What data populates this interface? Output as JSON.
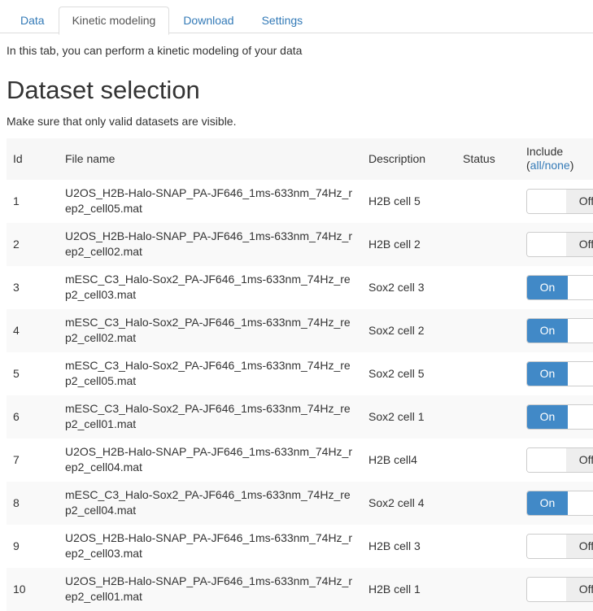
{
  "tabs": [
    {
      "label": "Data",
      "active": false
    },
    {
      "label": "Kinetic modeling",
      "active": true
    },
    {
      "label": "Download",
      "active": false
    },
    {
      "label": "Settings",
      "active": false
    }
  ],
  "intro_text": "In this tab, you can perform a kinetic modeling of your data",
  "page_title": "Dataset selection",
  "subtitle": "Make sure that only valid datasets are visible.",
  "colors": {
    "link": "#337ab7",
    "toggle_on": "#4189c7",
    "toggle_off_track": "#eeeeee",
    "header_bg": "#f7f7f7",
    "row_stripe": "#f9f9f9",
    "border": "#dddddd"
  },
  "table": {
    "headers": {
      "id": "Id",
      "file_name": "File name",
      "description": "Description",
      "status": "Status",
      "include": "Include",
      "include_all": "all",
      "include_separator": "/",
      "include_none": "none",
      "include_open_paren": "(",
      "include_close_paren": ")"
    },
    "toggle_labels": {
      "on": "On",
      "off": "Off"
    },
    "rows": [
      {
        "id": "1",
        "file_name": "U2OS_H2B-Halo-SNAP_PA-JF646_1ms-633nm_74Hz_rep2_cell05.mat",
        "description": "H2B cell 5",
        "status": "",
        "include": "Off"
      },
      {
        "id": "2",
        "file_name": "U2OS_H2B-Halo-SNAP_PA-JF646_1ms-633nm_74Hz_rep2_cell02.mat",
        "description": "H2B cell 2",
        "status": "",
        "include": "Off"
      },
      {
        "id": "3",
        "file_name": "mESC_C3_Halo-Sox2_PA-JF646_1ms-633nm_74Hz_rep2_cell03.mat",
        "description": "Sox2 cell 3",
        "status": "",
        "include": "On"
      },
      {
        "id": "4",
        "file_name": "mESC_C3_Halo-Sox2_PA-JF646_1ms-633nm_74Hz_rep2_cell02.mat",
        "description": "Sox2 cell 2",
        "status": "",
        "include": "On"
      },
      {
        "id": "5",
        "file_name": "mESC_C3_Halo-Sox2_PA-JF646_1ms-633nm_74Hz_rep2_cell05.mat",
        "description": "Sox2 cell 5",
        "status": "",
        "include": "On"
      },
      {
        "id": "6",
        "file_name": "mESC_C3_Halo-Sox2_PA-JF646_1ms-633nm_74Hz_rep2_cell01.mat",
        "description": "Sox2 cell 1",
        "status": "",
        "include": "On"
      },
      {
        "id": "7",
        "file_name": "U2OS_H2B-Halo-SNAP_PA-JF646_1ms-633nm_74Hz_rep2_cell04.mat",
        "description": "H2B cell4",
        "status": "",
        "include": "Off"
      },
      {
        "id": "8",
        "file_name": "mESC_C3_Halo-Sox2_PA-JF646_1ms-633nm_74Hz_rep2_cell04.mat",
        "description": "Sox2 cell 4",
        "status": "",
        "include": "On"
      },
      {
        "id": "9",
        "file_name": "U2OS_H2B-Halo-SNAP_PA-JF646_1ms-633nm_74Hz_rep2_cell03.mat",
        "description": "H2B cell 3",
        "status": "",
        "include": "Off"
      },
      {
        "id": "10",
        "file_name": "U2OS_H2B-Halo-SNAP_PA-JF646_1ms-633nm_74Hz_rep2_cell01.mat",
        "description": "H2B cell 1",
        "status": "",
        "include": "Off"
      }
    ]
  }
}
